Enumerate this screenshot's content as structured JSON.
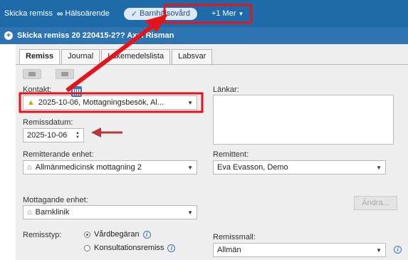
{
  "topbar": {
    "send_referral": "Skicka remiss",
    "health_issue": "Hälsoärende",
    "active_pill": "Barnhälsovård",
    "more": "+1 Mer"
  },
  "header": {
    "title": "Skicka remiss 20 220415-2?? Axel Risman"
  },
  "tabs": [
    "Remiss",
    "Journal",
    "Läkemedelslista",
    "Labsvar"
  ],
  "form": {
    "contact_label": "Kontakt:",
    "contact_value": "2025-10-06, Mottagningsbesök, Al...",
    "links_label": "Länkar:",
    "referral_date_label": "Remissdatum:",
    "referral_date_value": "2025-10-06",
    "referring_unit_label": "Remitterande enhet:",
    "referring_unit_value": "Allmänmedicinsk mottagning 2",
    "referrer_label": "Remittent:",
    "referrer_value": "Eva Evasson, Demo",
    "receiving_unit_label": "Mottagande enhet:",
    "receiving_unit_value": "Barnklinik",
    "change_button": "Ändra...",
    "referral_type_label": "Remisstyp:",
    "type_option_1": "Vårdbegäran",
    "type_option_2": "Konsultationsremiss",
    "template_label": "Remissmall:",
    "template_value": "Allmän"
  },
  "colors": {
    "topbar": "#1f6aa8",
    "header": "#2d74b0",
    "annotation_red": "#e4141b",
    "arrow_dark_red": "#b5383a"
  }
}
